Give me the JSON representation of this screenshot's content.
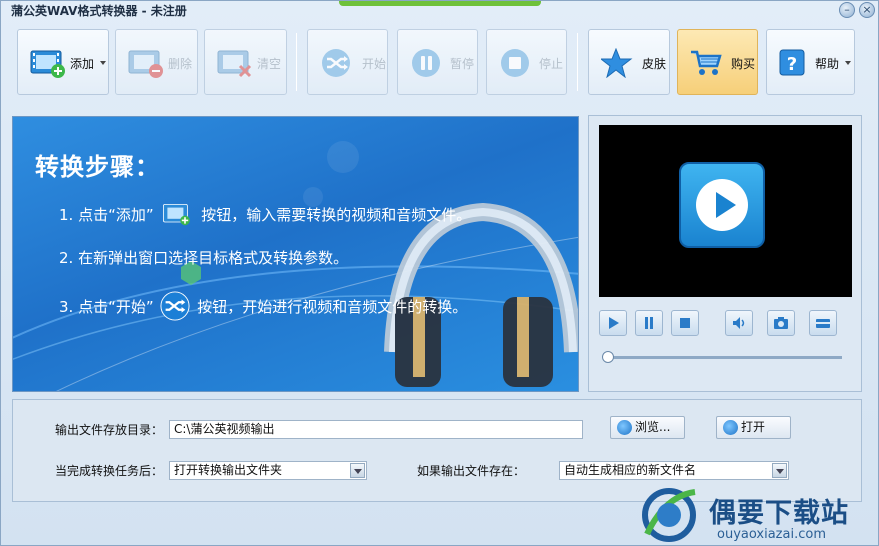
{
  "window": {
    "title": "蒲公英WAV格式转换器 - 未注册",
    "minimize_glyph": "–",
    "close_glyph": "×"
  },
  "toolbar": {
    "add_label": "添加",
    "delete_label": "删除",
    "clear_label": "清空",
    "start_label": "开始",
    "pause_label": "暂停",
    "stop_label": "停止",
    "skin_label": "皮肤",
    "buy_label": "购买",
    "help_label": "帮助"
  },
  "banner": {
    "title": "转换步骤：",
    "step1_a": "1. 点击“添加”",
    "step1_b": "按钮，输入需要转换的视频和音频文件。",
    "step2": "2. 在新弹出窗口选择目标格式及转换参数。",
    "step3_a": "3. 点击“开始”",
    "step3_b": "按钮，开始进行视频和音频文件的转换。"
  },
  "player": {
    "icons": [
      "play-icon",
      "pause-icon",
      "stop-icon",
      "volume-icon",
      "camera-icon",
      "fullscreen-icon"
    ],
    "progress": 0
  },
  "settings": {
    "output_dir_label": "输出文件存放目录：",
    "output_dir_value": "C:\\蒲公英视频输出",
    "browse_label": "浏览...",
    "open_label": "打开",
    "after_done_label": "当完成转换任务后：",
    "after_done_value": "打开转换输出文件夹",
    "if_exists_label": "如果输出文件存在：",
    "if_exists_value": "自动生成相应的新文件名"
  },
  "watermark": {
    "text": "偶要下载站",
    "url": "ouyaoxiazai.com"
  },
  "colors": {
    "accent_blue": "#1f71c9",
    "active_button": "#f6cf79",
    "title_accent": "#6fc13a"
  }
}
